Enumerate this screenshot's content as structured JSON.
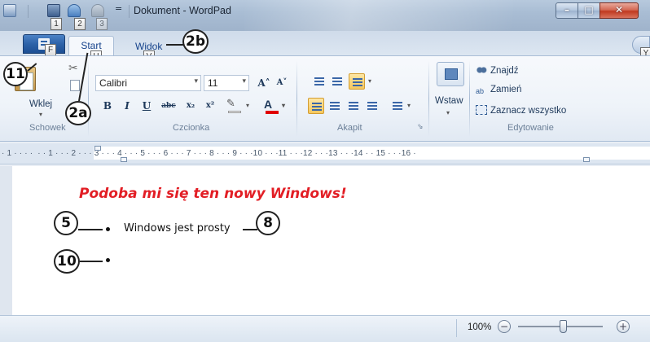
{
  "window": {
    "title": "Dokument - WordPad",
    "qat_dropdown": "=",
    "controls": {
      "minimize": "–",
      "maximize": "□",
      "close": "✕"
    }
  },
  "keytips": {
    "qat_save": "1",
    "qat_undo": "2",
    "qat_redo": "3",
    "app_menu": "F",
    "tab_start": "H",
    "tab_view": "V",
    "help": "Y"
  },
  "tabs": {
    "start": "Start",
    "view": "Widok"
  },
  "ribbon": {
    "clipboard": {
      "paste_label": "Wklej",
      "group_label": "Schowek"
    },
    "font": {
      "family": "Calibri",
      "size": "11",
      "grow": "A˄",
      "shrink": "A˅",
      "bold": "B",
      "italic": "I",
      "underline": "U",
      "strike": "abc",
      "subscript": "x₂",
      "superscript": "x²",
      "color_letter": "A",
      "group_label": "Czcionka"
    },
    "paragraph": {
      "group_label": "Akapit",
      "launcher": "⇘"
    },
    "insert": {
      "label": "Wstaw"
    },
    "editing": {
      "find": "Znajdź",
      "replace": "Zamień",
      "select_all": "Zaznacz wszystko",
      "group_label": "Edytowanie"
    }
  },
  "ruler": {
    "text": "· 1 · · · ·  · · 1 · · · 2 · · · 3 · · · 4 · · · 5 · · · 6 · · · 7 · · · 8 · · · 9 · · ·10 · · ·11 · · ·12 · · ·13 · · ·14 · · 15 · · ·16 ·"
  },
  "document": {
    "heading": "Podoba mi się ten nowy Windows!",
    "heading_color": "#e21e25",
    "bullets": [
      "Windows jest prosty",
      ""
    ]
  },
  "statusbar": {
    "zoom": "100%",
    "zoom_out": "−",
    "zoom_in": "+"
  },
  "callouts": {
    "app_menu": "11",
    "start_tab": "2a",
    "view_tab": "2b",
    "bullet_one": "5",
    "text_end": "8",
    "bullet_two": "10"
  }
}
